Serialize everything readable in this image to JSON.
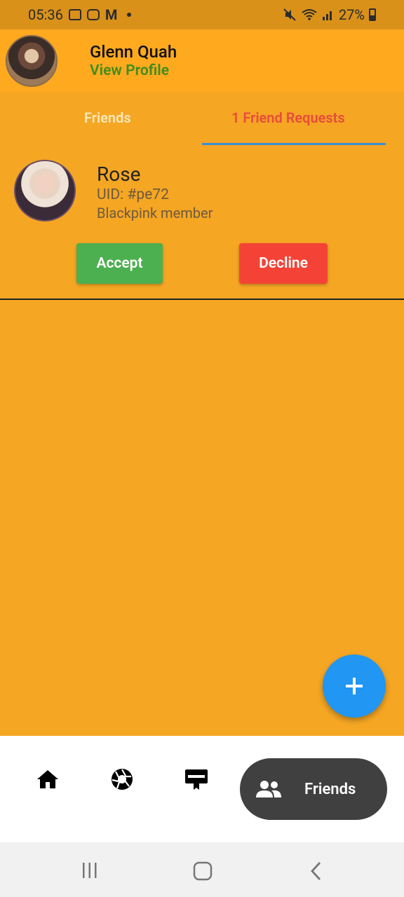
{
  "status_bar": {
    "time": "05:36",
    "battery": "27%"
  },
  "header": {
    "user_name": "Glenn Quah",
    "view_profile": "View Profile"
  },
  "tabs": [
    {
      "label": "Friends"
    },
    {
      "label": "1 Friend Requests"
    }
  ],
  "request": {
    "name": "Rose",
    "uid": "UID: #pe72",
    "description": "Blackpink member",
    "accept_label": "Accept",
    "decline_label": "Decline"
  },
  "fab": {
    "icon": "plus-icon"
  },
  "bottom_nav": {
    "items": [
      {
        "icon": "home-icon"
      },
      {
        "icon": "camera-aperture-icon"
      },
      {
        "icon": "card-icon"
      },
      {
        "icon": "friends-icon",
        "label": "Friends",
        "active": true
      }
    ]
  },
  "colors": {
    "background": "#F5A623",
    "header": "#FFA91F",
    "accent_tab": "#E74C3C",
    "tab_indicator": "#3A8CD4",
    "accept": "#4CAF50",
    "decline": "#F44336",
    "fab": "#2196F3"
  }
}
